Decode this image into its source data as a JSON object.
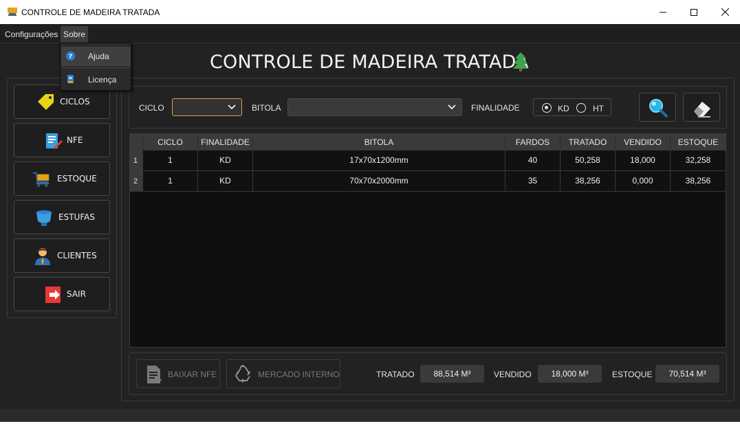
{
  "window": {
    "title": "CONTROLE DE MADEIRA TRATADA"
  },
  "menu": {
    "items": [
      "Configurações",
      "Sobre"
    ],
    "sobre_dropdown": [
      "Ajuda",
      "Licença"
    ]
  },
  "header": {
    "title": "CONTROLE DE MADEIRA TRATADA"
  },
  "sidebar": {
    "items": [
      {
        "label": "CICLOS",
        "icon": "tag-icon"
      },
      {
        "label": "NFE",
        "icon": "invoice-edit-icon"
      },
      {
        "label": "ESTOQUE",
        "icon": "cart-icon"
      },
      {
        "label": "ESTUFAS",
        "icon": "kiln-icon"
      },
      {
        "label": "CLIENTES",
        "icon": "person-icon"
      },
      {
        "label": "SAIR",
        "icon": "exit-icon"
      }
    ]
  },
  "filters": {
    "ciclo_label": "CICLO",
    "ciclo_value": "",
    "bitola_label": "BITOLA",
    "bitola_value": "",
    "finalidade_label": "FINALIDADE",
    "finalidade_options": [
      "KD",
      "HT"
    ],
    "finalidade_selected": "KD"
  },
  "table": {
    "columns": [
      "CICLO",
      "FINALIDADE",
      "BITOLA",
      "FARDOS",
      "TRATADO",
      "VENDIDO",
      "ESTOQUE"
    ],
    "rows": [
      {
        "n": "1",
        "ciclo": "1",
        "finalidade": "KD",
        "bitola": "17x70x1200mm",
        "fardos": "40",
        "tratado": "50,258",
        "vendido": "18,000",
        "estoque": "32,258"
      },
      {
        "n": "2",
        "ciclo": "1",
        "finalidade": "KD",
        "bitola": "70x70x2000mm",
        "fardos": "35",
        "tratado": "38,256",
        "vendido": "0,000",
        "estoque": "38,256"
      }
    ]
  },
  "footer": {
    "baixar_nfe": "BAIXAR NFE",
    "mercado_interno": "MERCADO INTERNO",
    "tratado_label": "TRATADO",
    "tratado_value": "88,514 M³",
    "vendido_label": "VENDIDO",
    "vendido_value": "18,000 M³",
    "estoque_label": "ESTOQUE",
    "estoque_value": "70,514 M³"
  },
  "colors": {
    "background": "#222222",
    "accent_combo": "#d9a441",
    "search_icon": "#29b6e8"
  }
}
